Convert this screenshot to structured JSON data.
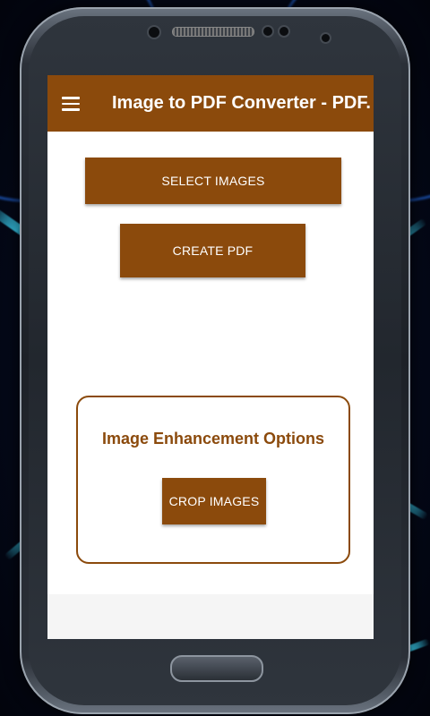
{
  "app_bar": {
    "title": "Image to PDF Converter - PDF...",
    "menu_icon": "hamburger-menu-icon",
    "color": "#8B4A0C"
  },
  "actions": {
    "select_images_label": "SELECT IMAGES",
    "create_pdf_label": "CREATE PDF"
  },
  "enhancement_panel": {
    "title": "Image Enhancement Options",
    "crop_images_label": "CROP IMAGES"
  },
  "theme": {
    "accent": "#8B4A0C",
    "screen_background": "#FFFFFF"
  }
}
